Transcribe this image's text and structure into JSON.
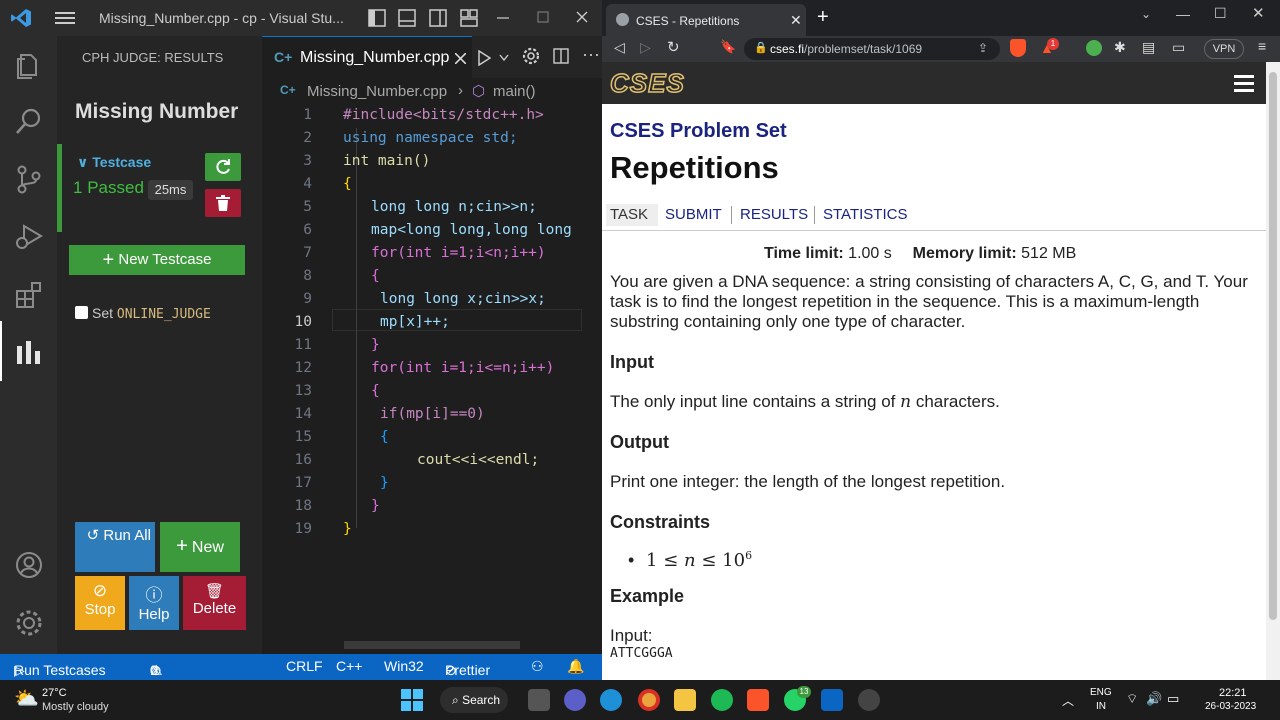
{
  "vscode": {
    "title": "Missing_Number.cpp - cp - Visual Stu...",
    "cph": {
      "header": "CPH JUDGE: RESULTS",
      "problem_title": "Missing Number",
      "testcase_label": "Testcase",
      "testcase_num": "1",
      "status": "Passed",
      "time": "25ms",
      "new_testcase": "New Testcase",
      "online_judge_prefix": "Set",
      "online_judge_code": "ONLINE_JUDGE",
      "run_all": "Run All",
      "new": "New",
      "stop": "Stop",
      "help": "Help",
      "delete": "Delete"
    },
    "tab_filename": "Missing_Number.cpp",
    "breadcrumb_file": "Missing_Number.cpp",
    "breadcrumb_symbol": "main()",
    "code_lines": [
      "#include<bits/stdc++.h>",
      "using namespace std;",
      "int main()",
      "{",
      "long long n;cin>>n;",
      "map<long long,long long",
      "for(int i=1;i<n;i++)",
      "{",
      "long long x;cin>>x;",
      "mp[x]++;",
      "}",
      "for(int i=1;i<=n;i++)",
      "{",
      "if(mp[i]==0)",
      "{",
      "cout<<i<<endl;",
      "}",
      "}",
      "}"
    ],
    "line_numbers": [
      "1",
      "2",
      "3",
      "4",
      "5",
      "6",
      "7",
      "8",
      "9",
      "10",
      "11",
      "12",
      "13",
      "14",
      "15",
      "16",
      "17",
      "18",
      "19"
    ],
    "status": {
      "run_testcases": "Run Testcases",
      "errors": "0",
      "warnings": "0",
      "eol": "CRLF",
      "lang": "C++",
      "platform": "Win32",
      "prettier": "Prettier"
    }
  },
  "browser": {
    "tab_title": "CSES - Repetitions",
    "url_domain": "cses.fi",
    "url_path": "/problemset/task/1069",
    "vpn": "VPN",
    "brave_badge": "1",
    "logo": "CSES",
    "problem_set": "CSES Problem Set",
    "title": "Repetitions",
    "nav": [
      "TASK",
      "SUBMIT",
      "RESULTS",
      "STATISTICS"
    ],
    "time_limit_label": "Time limit:",
    "time_limit": "1.00 s",
    "memory_limit_label": "Memory limit:",
    "memory_limit": "512 MB",
    "description": "You are given a DNA sequence: a string consisting of characters A, C, G, and T. Your task is to find the longest repetition in the sequence. This is a maximum-length substring containing only one type of character.",
    "input_heading": "Input",
    "input_text_a": "The only input line contains a string of",
    "input_var": "n",
    "input_text_b": "characters.",
    "output_heading": "Output",
    "output_text": "Print one integer: the length of the longest repetition.",
    "constraints_heading": "Constraints",
    "constraint_lhs": "1 ≤",
    "constraint_var": "n",
    "constraint_rhs": "≤ 10",
    "constraint_exp": "6",
    "example_heading": "Example",
    "example_input_label": "Input:",
    "example_input": "ATTCGGGA"
  },
  "taskbar": {
    "temp": "27°C",
    "weather": "Mostly cloudy",
    "search": "Search",
    "lang_top": "ENG",
    "lang_bottom": "IN",
    "time": "22:21",
    "date": "26-03-2023",
    "whatsapp_badge": "13"
  },
  "colors": {
    "vscode_accent": "#0b66c3",
    "green_btn": "#3c9a3c",
    "run_all": "#2e7dba",
    "stop": "#f0a81c",
    "help": "#2e7dba",
    "delete": "#a51d35",
    "cses_blue": "#1a237e"
  }
}
